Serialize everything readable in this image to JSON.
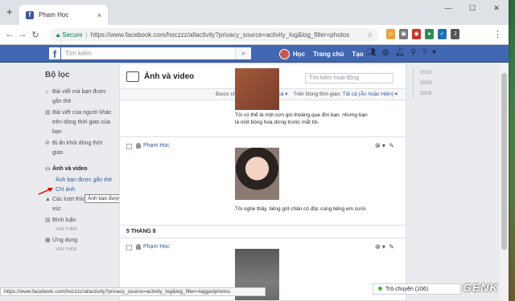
{
  "browser": {
    "tab_title": "Phạm Học",
    "tab_favicon": "f",
    "new_tab": "+",
    "tab_close": "×",
    "window_controls": [
      "—",
      "☐",
      "✕"
    ],
    "secure_label": "Secure",
    "url": "https://www.facebook.com/hoczzz/allactivity?privacy_source=activity_log&log_filter=photos",
    "extensions": [
      "extension-orange",
      "extension-gray",
      "extension-red",
      "extension-green",
      "extension-blue",
      "extension-j"
    ],
    "ext_labels": [
      "☺",
      "▣",
      "◉",
      "●",
      "✓",
      "J"
    ],
    "ext_colors": [
      "#e8a33d",
      "#777777",
      "#c0392b",
      "#2e8b57",
      "#1f6fb2",
      "#555555"
    ]
  },
  "fb": {
    "logo": "f",
    "search_placeholder": "Tìm kiếm",
    "user_name": "Học",
    "home": "Trang chủ",
    "create": "Tạo",
    "brand_color": "#4267b2"
  },
  "leftnav": {
    "heading": "Bộ lọc",
    "items": [
      {
        "icon": "tag-icon",
        "glyph": "⌂",
        "label": "Bài viết mà bạn được gắn thẻ"
      },
      {
        "icon": "comment-icon",
        "glyph": "▤",
        "label": "Bài viết của người khác trên dòng thời gian của bạn"
      },
      {
        "icon": "hidden-icon",
        "glyph": "⊘",
        "label": "Bị ẩn khỏi dòng thời gian"
      }
    ],
    "photos": {
      "icon": "photos-icon",
      "glyph": "▭",
      "label": "Ảnh và video"
    },
    "photo_subs": [
      "Ảnh bạn được gắn thẻ",
      "Chỉ ảnh"
    ],
    "likes": {
      "icon": "like-icon",
      "glyph": "▲",
      "label": "Các lượt thích và cảm xúc"
    },
    "comments": {
      "icon": "comments-icon",
      "glyph": "▤",
      "label": "Bình luận"
    },
    "more1": "XEM THÊM",
    "apps": {
      "icon": "apps-icon",
      "glyph": "▦",
      "label": "Ứng dụng"
    },
    "more2": "XEM THÊM",
    "tooltip": "Ảnh bạn được gắn thẻ"
  },
  "main": {
    "title": "Ảnh và video",
    "search_placeholder": "Tìm kiếm hoạt động",
    "filter_shared_label": "Được chia sẻ với:",
    "filter_shared_value": "Xem tất cả",
    "filter_timeline_label": "Trên Dòng thời gian:",
    "filter_timeline_value": "Tất cả (Ẩn hoặc Hiện)",
    "entries": [
      {
        "user": "",
        "caption": "Tôi có thể là một cơn gió thoảng qua đời bạn, nhưng bạn là một bông hoa dừng trước mắt tôi."
      },
      {
        "user": "Phạm Học",
        "caption": "Tôi nghe thấy, tiếng gót chân cô độc cùng tiếng em cười."
      },
      {
        "user": "Phạm Học",
        "caption": ""
      }
    ],
    "date_header": "5 THÁNG 8"
  },
  "years": [
    "2010",
    "2009",
    "2008"
  ],
  "status_url": "https://www.facebook.com/hoczzz/allactivity?privacy_source=activity_log&log_filter=taggedphotos",
  "chat": "Trò chuyện (106)",
  "watermark": "GENK"
}
